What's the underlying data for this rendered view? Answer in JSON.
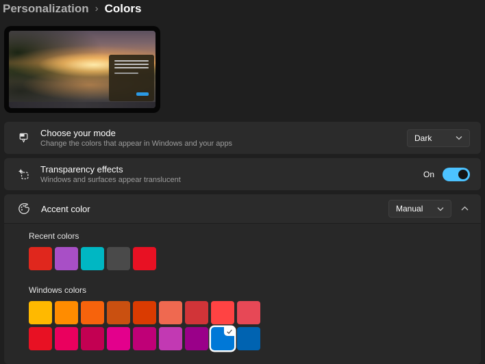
{
  "breadcrumb": {
    "parent": "Personalization",
    "separator": "›",
    "current": "Colors"
  },
  "settings": {
    "mode": {
      "title": "Choose your mode",
      "subtitle": "Change the colors that appear in Windows and your apps",
      "value": "Dark"
    },
    "transparency": {
      "title": "Transparency effects",
      "subtitle": "Windows and surfaces appear translucent",
      "state": "On"
    },
    "accent": {
      "title": "Accent color",
      "value": "Manual"
    }
  },
  "recent_colors": {
    "label": "Recent colors",
    "swatches": [
      "#e0271d",
      "#a84fc6",
      "#00b7c3",
      "#4a4a4a",
      "#e81123"
    ]
  },
  "windows_colors": {
    "label": "Windows colors",
    "rows": [
      [
        "#ffb900",
        "#ff8c00",
        "#f7630c",
        "#ca5010",
        "#da3b01",
        "#ef6950",
        "#d13438",
        "#ff4343",
        "#e74856"
      ],
      [
        "#e81123",
        "#ea005e",
        "#c30052",
        "#e3008c",
        "#bf0077",
        "#c239b3",
        "#9a0089",
        "#0078d7",
        "#0063b1"
      ]
    ],
    "selected": {
      "row": 1,
      "index": 7,
      "value": "#0078d7"
    }
  },
  "colors": {
    "page_background": "#1f1f1f",
    "card_background": "#2b2b2b",
    "expanded_body_background": "#282828",
    "toggle_on": "#4cc2ff",
    "preview_button_blue": "#2b9ae6",
    "selected_accent": "#0078d7"
  },
  "icons": {
    "mode": "paint-tool",
    "transparency": "sparkle-dashed-square",
    "accent": "palette",
    "dropdown": "chevron-down",
    "expander": "chevron-up",
    "selected_swatch": "checkmark"
  }
}
